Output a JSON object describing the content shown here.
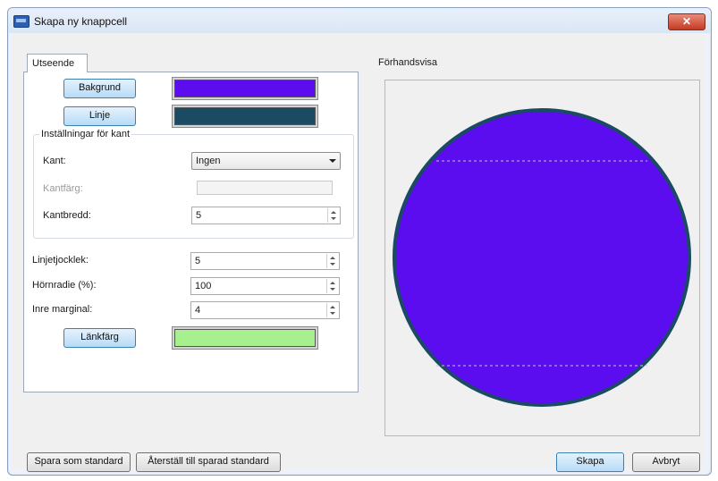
{
  "window": {
    "title": "Skapa ny knappcell",
    "close_label": "✕"
  },
  "tabs": [
    {
      "label": "Utseende"
    }
  ],
  "appearance": {
    "background_button": "Bakgrund",
    "background_color": "#5b0df0",
    "line_button": "Linje",
    "line_color": "#1b4a63",
    "border_group": {
      "title": "Inställningar för kant",
      "border_label": "Kant:",
      "border_value": "Ingen",
      "border_color_label": "Kantfärg:",
      "border_width_label": "Kantbredd:",
      "border_width_value": "5"
    },
    "line_thickness_label": "Linjetjocklek:",
    "line_thickness_value": "5",
    "corner_radius_label": "Hörnradie (%):",
    "corner_radius_value": "100",
    "inner_margin_label": "Inre marginal:",
    "inner_margin_value": "4",
    "link_color_button": "Länkfärg",
    "link_color": "#a6f08e"
  },
  "preview": {
    "label": "Förhandsvisa"
  },
  "footer": {
    "save_default": "Spara som standard",
    "restore_default": "Återställ till sparad standard",
    "create": "Skapa",
    "cancel": "Avbryt"
  }
}
